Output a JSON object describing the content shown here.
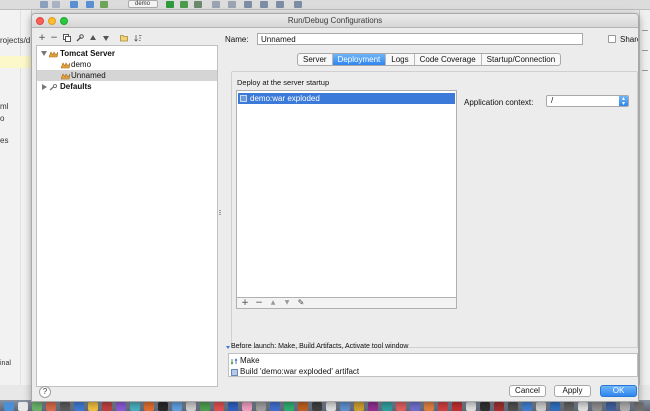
{
  "window": {
    "title": "Run/Debug Configurations"
  },
  "background_ide": {
    "run_config": "demo",
    "path_fragment": "rojects/d",
    "fragments": [
      "ml",
      "o",
      "es"
    ],
    "bottom_fragment": "inal"
  },
  "tree_toolbar": {
    "add_icon": "plus-icon",
    "remove_icon": "minus-icon",
    "copy_icon": "copy-icon",
    "edit_defaults_icon": "wrench-icon",
    "move_up_icon": "arrow-up-icon",
    "move_down_icon": "arrow-down-icon",
    "folder_icon": "folder-icon",
    "sort_icon": "sort-icon"
  },
  "tree": {
    "items": [
      {
        "label": "Tomcat Server",
        "level": 0,
        "expanded": true,
        "bold": true,
        "icon": "tomcat-icon"
      },
      {
        "label": "demo",
        "level": 1,
        "icon": "tomcat-icon"
      },
      {
        "label": "Unnamed",
        "level": 1,
        "selected": true,
        "icon": "tomcat-icon"
      },
      {
        "label": "Defaults",
        "level": 0,
        "expanded": false,
        "bold": true,
        "icon": "wrench-icon"
      }
    ]
  },
  "name_row": {
    "label": "Name:",
    "value": "Unnamed",
    "share_label": "Share",
    "share_checked": false
  },
  "tabs": [
    {
      "label": "Server",
      "active": false
    },
    {
      "label": "Deployment",
      "active": true
    },
    {
      "label": "Logs",
      "active": false
    },
    {
      "label": "Code Coverage",
      "active": false
    },
    {
      "label": "Startup/Connection",
      "active": false
    }
  ],
  "deployment": {
    "section_label": "Deploy at the server startup",
    "artifacts": [
      {
        "label": "demo:war exploded",
        "selected": true
      }
    ],
    "list_toolbar": [
      "+",
      "−",
      "▲",
      "▼",
      "✎"
    ],
    "context_label": "Application context:",
    "context_value": "/"
  },
  "before_launch": {
    "header": "Before launch: Make, Build Artifacts, Activate tool window",
    "items": [
      {
        "label": "Make",
        "icon": "make-icon"
      },
      {
        "label": "Build 'demo:war exploded' artifact",
        "icon": "artifact-icon"
      }
    ]
  },
  "buttons": {
    "help": "?",
    "cancel": "Cancel",
    "apply": "Apply",
    "ok": "OK"
  },
  "colors": {
    "accent": "#2f86f0",
    "selection": "#3b7ad9",
    "tree_selection": "#d5d5d5"
  }
}
